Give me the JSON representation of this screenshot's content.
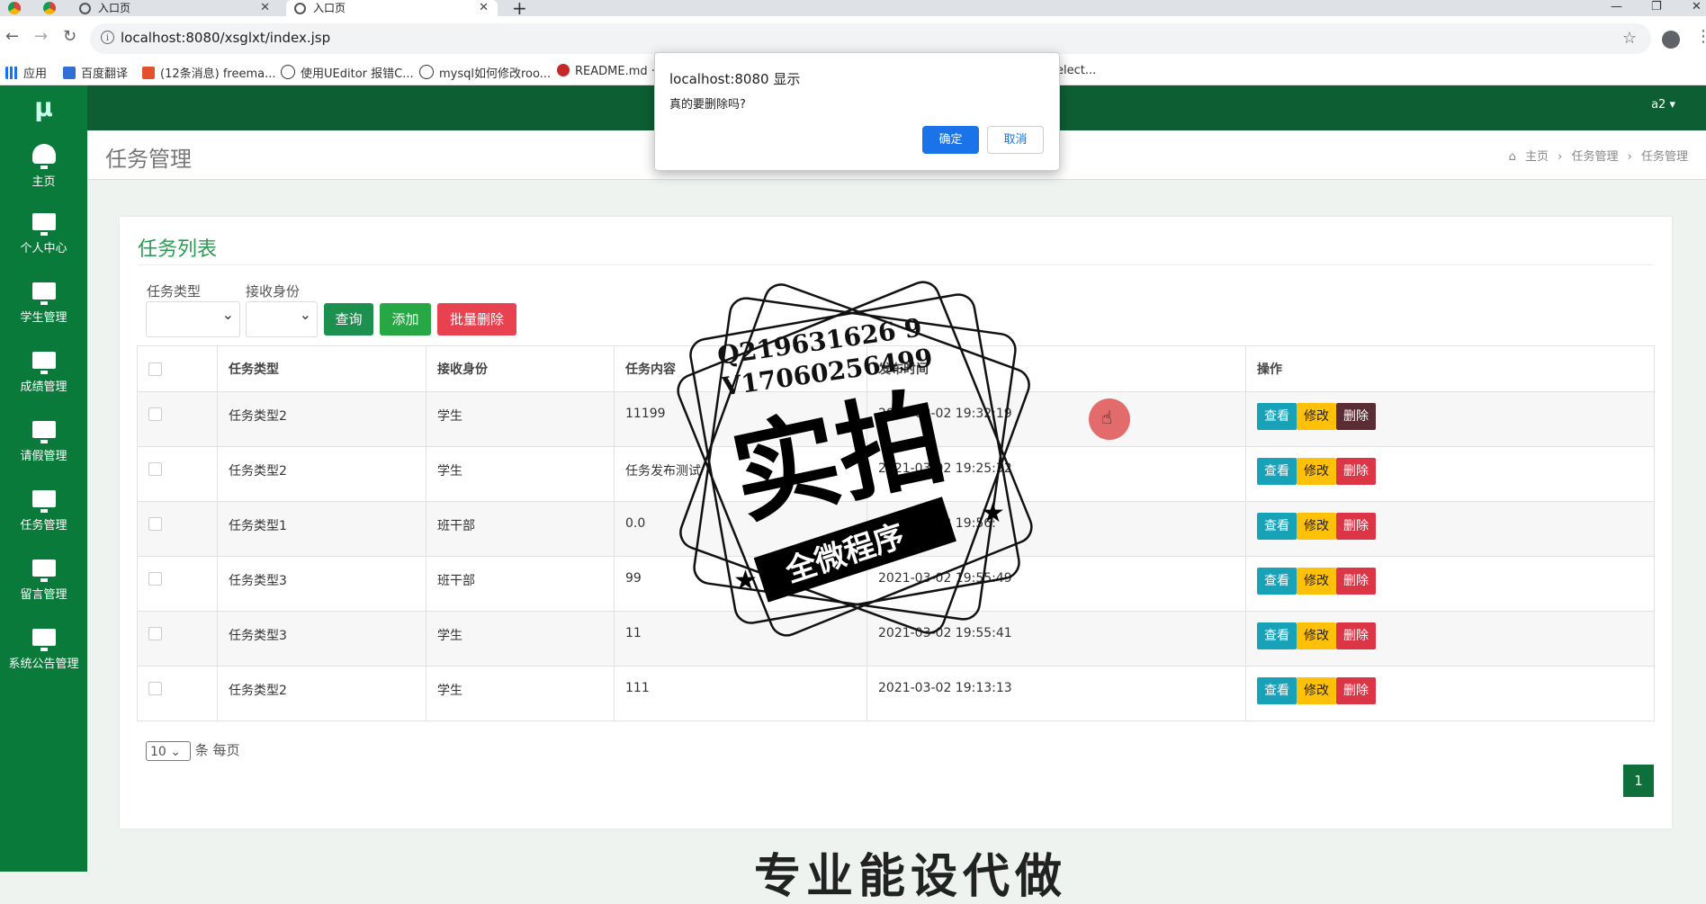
{
  "browser": {
    "tabs": [
      "入口页",
      "入口页"
    ],
    "url": "localhost:8080/xsglxt/index.jsp",
    "bookmarks": [
      "应用",
      "百度翻译",
      "(12条消息) freema...",
      "使用UEditor 报错C...",
      "mysql如何修改roo...",
      "README.md ·",
      "elect..."
    ]
  },
  "app": {
    "logo": "μ",
    "user": "a2 ▾",
    "sidebar": [
      {
        "label": "主页",
        "icon": "dashboard-icon"
      },
      {
        "label": "个人中心",
        "icon": "monitor-icon"
      },
      {
        "label": "学生管理",
        "icon": "monitor-icon"
      },
      {
        "label": "成绩管理",
        "icon": "monitor-icon"
      },
      {
        "label": "请假管理",
        "icon": "monitor-icon"
      },
      {
        "label": "任务管理",
        "icon": "monitor-icon"
      },
      {
        "label": "留言管理",
        "icon": "monitor-icon"
      },
      {
        "label": "系统公告管理",
        "icon": "monitor-icon"
      }
    ],
    "page_title": "任务管理",
    "breadcrumb": [
      "主页",
      "›",
      "任务管理",
      "›",
      "任务管理"
    ]
  },
  "card": {
    "title": "任务列表",
    "filters": {
      "task_type_label": "任务类型",
      "recv_label": "接收身份"
    },
    "buttons": {
      "query": "查询",
      "add": "添加",
      "batch_delete": "批量删除"
    },
    "columns": [
      "任务类型",
      "接收身份",
      "任务内容",
      "发布时间",
      "操作"
    ],
    "rows": [
      {
        "type": "任务类型2",
        "recv": "学生",
        "content": "11199",
        "time": "2021-03-02 19:32:19"
      },
      {
        "type": "任务类型2",
        "recv": "学生",
        "content": "任务发布测试",
        "time": "2021-03-02 19:25:32"
      },
      {
        "type": "任务类型1",
        "recv": "班干部",
        "content": "0.0",
        "time": "2021-03-02 19:56:"
      },
      {
        "type": "任务类型3",
        "recv": "班干部",
        "content": "99",
        "time": "2021-03-02 19:55:49"
      },
      {
        "type": "任务类型3",
        "recv": "学生",
        "content": "11",
        "time": "2021-03-02 19:55:41"
      },
      {
        "type": "任务类型2",
        "recv": "学生",
        "content": "111",
        "time": "2021-03-02 19:13:13"
      }
    ],
    "row_actions": {
      "view": "查看",
      "edit": "修改",
      "delete": "删除"
    },
    "page_size": "10",
    "page_size_suffix": "条 每页",
    "current_page": "1"
  },
  "footer_banner": "专业能设代做",
  "dialog": {
    "title": "localhost:8080 显示",
    "message": "真的要删除吗?",
    "ok": "确定",
    "cancel": "取消"
  },
  "watermark": {
    "qq": "Q219631626 9",
    "wx": "V17060256499",
    "main": "实拍",
    "ribbon": "全微程序"
  },
  "colors": {
    "sidebar": "#0a7a3a",
    "topbar": "#0e5e33",
    "accent": "#28a745",
    "danger": "#dc3545"
  }
}
